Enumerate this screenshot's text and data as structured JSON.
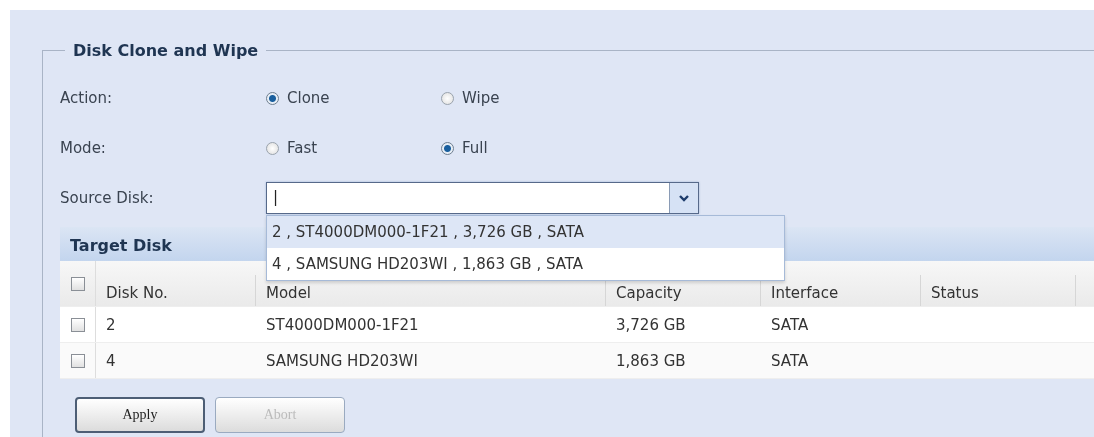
{
  "section": {
    "title": "Disk Clone and Wipe"
  },
  "action": {
    "label": "Action:",
    "options": [
      {
        "label": "Clone",
        "selected": true
      },
      {
        "label": "Wipe",
        "selected": false
      }
    ]
  },
  "mode": {
    "label": "Mode:",
    "options": [
      {
        "label": "Fast",
        "selected": false
      },
      {
        "label": "Full",
        "selected": true
      }
    ]
  },
  "source_disk": {
    "label": "Source Disk:",
    "value": "|",
    "expanded": true,
    "options": [
      {
        "label": "2 , ST4000DM000-1F21 , 3,726 GB , SATA",
        "selected": true
      },
      {
        "label": "4 , SAMSUNG HD203WI , 1,863 GB , SATA",
        "selected": false
      }
    ]
  },
  "target_disk": {
    "title": "Target Disk",
    "columns": [
      "Disk No.",
      "Model",
      "Capacity",
      "Interface",
      "Status"
    ],
    "header_checked": false,
    "rows": [
      {
        "checked": false,
        "cells": [
          "2",
          "ST4000DM000-1F21",
          "3,726 GB",
          "SATA",
          ""
        ]
      },
      {
        "checked": false,
        "cells": [
          "4",
          "SAMSUNG HD203WI",
          "1,863 GB",
          "SATA",
          ""
        ]
      }
    ]
  },
  "buttons": [
    {
      "label": "Apply",
      "disabled": false
    },
    {
      "label": "Abort",
      "disabled": true
    }
  ]
}
